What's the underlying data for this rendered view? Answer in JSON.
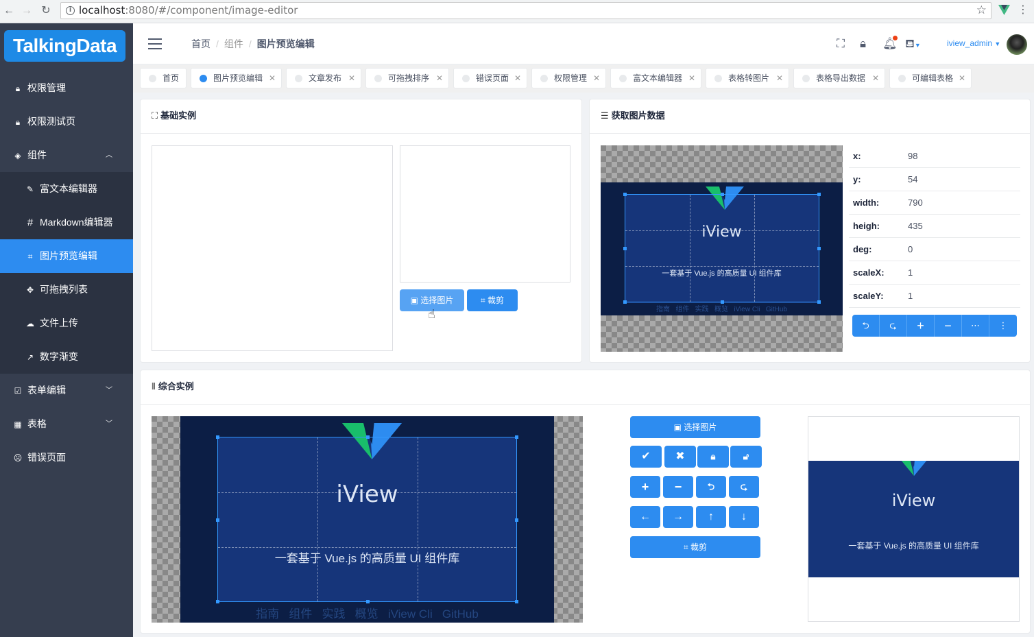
{
  "browser": {
    "url_host": "localhost",
    "url_rest": ":8080/#/component/image-editor"
  },
  "sidebar": {
    "logo": "TalkingData",
    "items": [
      {
        "label": "权限管理"
      },
      {
        "label": "权限测试页"
      },
      {
        "label": "组件"
      },
      {
        "label": "富文本编辑器"
      },
      {
        "label": "Markdown编辑器"
      },
      {
        "label": "图片预览编辑"
      },
      {
        "label": "可拖拽列表"
      },
      {
        "label": "文件上传"
      },
      {
        "label": "数字渐变"
      },
      {
        "label": "表单编辑"
      },
      {
        "label": "表格"
      },
      {
        "label": "错误页面"
      }
    ]
  },
  "header": {
    "breadcrumb": [
      "首页",
      "组件",
      "图片预览编辑"
    ],
    "user": "iview_admin"
  },
  "tabs": [
    "首页",
    "图片预览编辑",
    "文章发布",
    "可拖拽排序",
    "错误页面",
    "权限管理",
    "富文本编辑器",
    "表格转图片",
    "表格导出数据",
    "可编辑表格"
  ],
  "basic": {
    "title": "基础实例",
    "select_btn": "选择图片",
    "crop_btn": "裁剪"
  },
  "getdata": {
    "title": "获取图片数据",
    "rows": [
      {
        "k": "x:",
        "v": "98"
      },
      {
        "k": "y:",
        "v": "54"
      },
      {
        "k": "width:",
        "v": "790"
      },
      {
        "k": "heigh:",
        "v": "435"
      },
      {
        "k": "deg:",
        "v": "0"
      },
      {
        "k": "scaleX:",
        "v": "1"
      },
      {
        "k": "scaleY:",
        "v": "1"
      }
    ]
  },
  "full": {
    "title": "综合实例",
    "select_btn": "选择图片",
    "crop_btn": "裁剪"
  },
  "image_text": {
    "title": "iView",
    "subtitle": "一套基于 Vue.js 的高质量 UI 组件库",
    "footer": "指南   组件   实践   概览   iView Cli   GitHub"
  }
}
